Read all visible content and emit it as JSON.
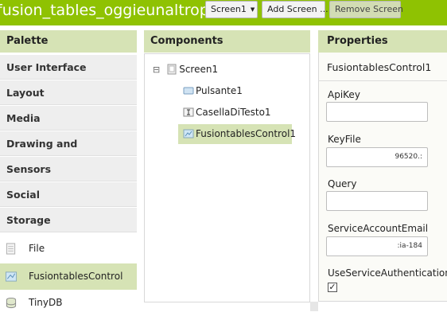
{
  "header": {
    "app_title": "fusion_tables_oggieunaltropost",
    "screen_select": "Screen1",
    "add_screen": "Add Screen ...",
    "remove_screen": "Remove Screen"
  },
  "palette": {
    "title": "Palette",
    "categories": [
      "User Interface",
      "Layout",
      "Media",
      "Drawing and Animation",
      "Sensors",
      "Social",
      "Storage"
    ],
    "items": [
      {
        "label": "File",
        "icon": "file-icon",
        "selected": false
      },
      {
        "label": "FusiontablesControl",
        "icon": "fusiontables-icon",
        "selected": true
      },
      {
        "label": "TinyDB",
        "icon": "database-icon",
        "selected": false
      }
    ]
  },
  "components": {
    "title": "Components",
    "tree": [
      {
        "label": "Screen1",
        "icon": "screen-icon",
        "level": 0,
        "collapse": "⊟"
      },
      {
        "label": "Pulsante1",
        "icon": "button-icon",
        "level": 1
      },
      {
        "label": "CasellaDiTesto1",
        "icon": "textbox-icon",
        "level": 1
      },
      {
        "label": "FusiontablesControl1",
        "icon": "fusiontables-icon",
        "level": 1,
        "selected": true
      }
    ]
  },
  "properties": {
    "title": "Properties",
    "component": "FusiontablesControl1",
    "fields": [
      {
        "label": "ApiKey",
        "value": ""
      },
      {
        "label": "KeyFile",
        "value": "96520.:"
      },
      {
        "label": "Query",
        "value": ""
      },
      {
        "label": "ServiceAccountEmail",
        "value": ":ia-184"
      }
    ],
    "use_service_auth_label": "UseServiceAuthentication",
    "use_service_auth_checked": "✓"
  },
  "colors": {
    "brand_green": "#8fc202",
    "panel_header": "#d6e3b5",
    "selection": "#d6e3b5"
  }
}
